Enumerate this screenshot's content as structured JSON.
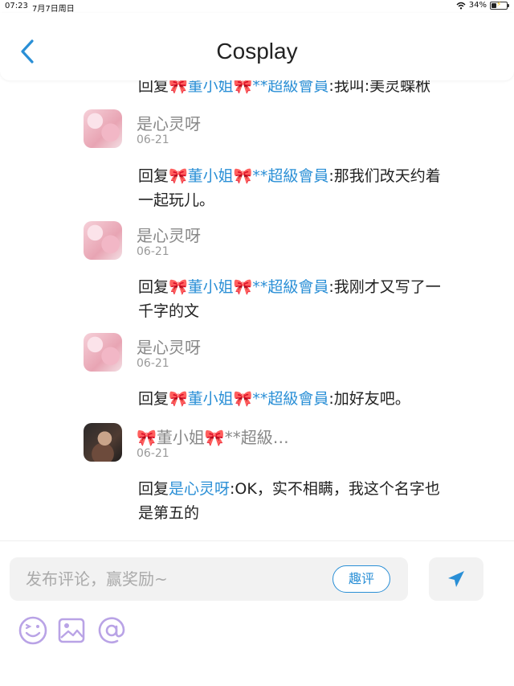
{
  "status_bar": {
    "time": "07:23",
    "date": "7月7日周日",
    "battery": "34%",
    "battery_level": 0.34
  },
  "header": {
    "title": "Cosplay"
  },
  "comments": [
    {
      "reply_prefix": "回复",
      "mention": "🎀董小姐🎀**超級會員",
      "text_lines": [
        ":我叫:美灵蝶栿"
      ]
    },
    {
      "username": "是心灵呀",
      "date": "06-21",
      "reply_prefix": "回复",
      "mention": "🎀董小姐🎀**超級會員",
      "line1_text": ":那我们改天约着",
      "line2_text": "一起玩儿。"
    },
    {
      "username": "是心灵呀",
      "date": "06-21",
      "reply_prefix": "回复",
      "mention": "🎀董小姐🎀**超級會員",
      "line1_text": ":我刚才又写了一",
      "line2_text": "千字的文"
    },
    {
      "username": "是心灵呀",
      "date": "06-21",
      "reply_prefix": "回复",
      "mention": "🎀董小姐🎀**超級會員",
      "line1_text": ":加好友吧。"
    },
    {
      "username": "🎀董小姐🎀**超級…",
      "date": "06-21",
      "reply_prefix": "回复",
      "mention": "是心灵呀",
      "line1_text": ":OK，实不相瞒，我这个名字也",
      "line2_text": "是第五的"
    }
  ],
  "composer": {
    "placeholder": "发布评论，赢奖励~",
    "quping_label": "趣评"
  },
  "icons": {
    "back": "chevron-left-icon",
    "send": "send-icon",
    "emoji": "emoji-icon",
    "image": "image-icon",
    "mention": "at-icon"
  },
  "colors": {
    "link": "#2a8fd6",
    "accent_purple": "#b9a3e6",
    "ribbon": "#e06a8a"
  }
}
